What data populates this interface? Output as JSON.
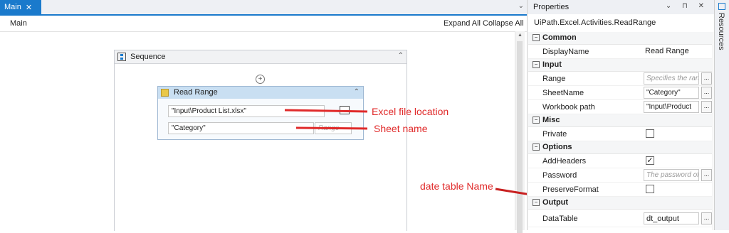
{
  "designer": {
    "tab_label": "Main",
    "breadcrumb": "Main",
    "expand_all": "Expand All",
    "collapse_all": "Collapse All",
    "sequence_title": "Sequence",
    "activity": {
      "title": "Read Range",
      "workbook_path": "\"Input\\Product List.xlsx\"",
      "sheet_name": "\"Category\"",
      "range_placeholder": "Range"
    }
  },
  "annotations": {
    "excel_file": "Excel file location",
    "sheet_name": "Sheet name",
    "table_name": "date table Name",
    "color": "#e02a2a"
  },
  "properties": {
    "title": "Properties",
    "type_name": "UiPath.Excel.Activities.ReadRange",
    "categories": {
      "common": "Common",
      "input": "Input",
      "misc": "Misc",
      "options": "Options",
      "output": "Output"
    },
    "rows": {
      "display_name": {
        "label": "DisplayName",
        "value": "Read Range"
      },
      "range": {
        "label": "Range",
        "placeholder": "Specifies the range"
      },
      "sheet_name": {
        "label": "SheetName",
        "value": "\"Category\""
      },
      "workbook_path": {
        "label": "Workbook path",
        "value": "\"Input\\Product"
      },
      "private": {
        "label": "Private",
        "checked": false
      },
      "add_headers": {
        "label": "AddHeaders",
        "checked": true,
        "mark": "✓"
      },
      "password": {
        "label": "Password",
        "placeholder": "The password of the"
      },
      "preserve_format": {
        "label": "PreserveFormat",
        "checked": false
      },
      "data_table": {
        "label": "DataTable",
        "value": "dt_output"
      }
    },
    "ellipsis": "...",
    "collapse_glyph": "−"
  },
  "rail": {
    "label": "Resources"
  },
  "colors": {
    "accent": "#1a7acc",
    "activity_header": "#c9dff2"
  }
}
